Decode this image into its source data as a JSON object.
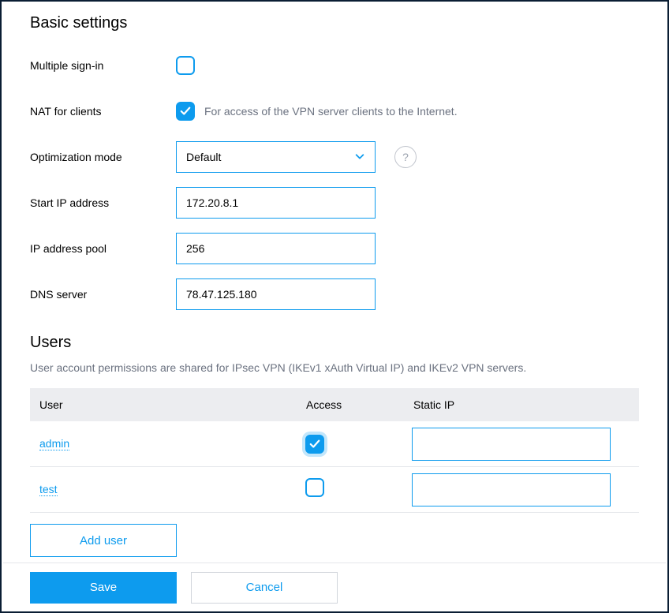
{
  "basic": {
    "title": "Basic settings",
    "multiple_signin_label": "Multiple sign-in",
    "multiple_signin_checked": false,
    "nat_label": "NAT for clients",
    "nat_checked": true,
    "nat_hint": "For access of the VPN server clients to the Internet.",
    "optimization_label": "Optimization mode",
    "optimization_value": "Default",
    "start_ip_label": "Start IP address",
    "start_ip_value": "172.20.8.1",
    "ip_pool_label": "IP address pool",
    "ip_pool_value": "256",
    "dns_label": "DNS server",
    "dns_value": "78.47.125.180"
  },
  "users": {
    "title": "Users",
    "hint": "User account permissions are shared for IPsec VPN (IKEv1 xAuth Virtual IP) and IKEv2 VPN servers.",
    "col_user": "User",
    "col_access": "Access",
    "col_staticip": "Static IP",
    "rows": [
      {
        "name": "admin",
        "access": true,
        "access_focused": true,
        "static_ip": ""
      },
      {
        "name": "test",
        "access": false,
        "access_focused": false,
        "static_ip": ""
      }
    ],
    "add_user_label": "Add user"
  },
  "footer": {
    "save_label": "Save",
    "cancel_label": "Cancel"
  }
}
